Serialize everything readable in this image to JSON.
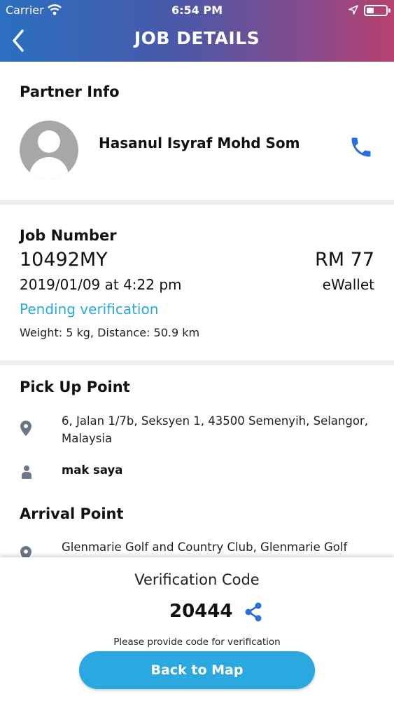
{
  "status_bar": {
    "carrier": "Carrier",
    "time": "6:54 PM"
  },
  "header": {
    "title": "JOB DETAILS"
  },
  "partner": {
    "section_title": "Partner Info",
    "name": "Hasanul Isyraf Mohd Som"
  },
  "job": {
    "section_title": "Job Number",
    "number": "10492MY",
    "price": "RM 77",
    "datetime": "2019/01/09 at 4:22 pm",
    "payment_method": "eWallet",
    "status": "Pending verification",
    "details": "Weight: 5 kg, Distance: 50.9 km"
  },
  "pickup": {
    "section_title": "Pick Up Point",
    "address": "6, Jalan 1/7b, Seksyen 1, 43500 Semenyih, Selangor, Malaysia",
    "contact": "mak saya"
  },
  "arrival": {
    "section_title": "Arrival Point",
    "address": "Glenmarie Golf and Country Club, Glenmarie Golf"
  },
  "verification": {
    "label": "Verification Code",
    "code": "20444",
    "hint": "Please provide code for verification"
  },
  "actions": {
    "back_to_map": "Back to Map"
  },
  "colors": {
    "accent": "#2ba8e0",
    "phone_icon": "#2a6fe0",
    "header_start": "#2a6fc0",
    "header_end": "#b8406e"
  }
}
